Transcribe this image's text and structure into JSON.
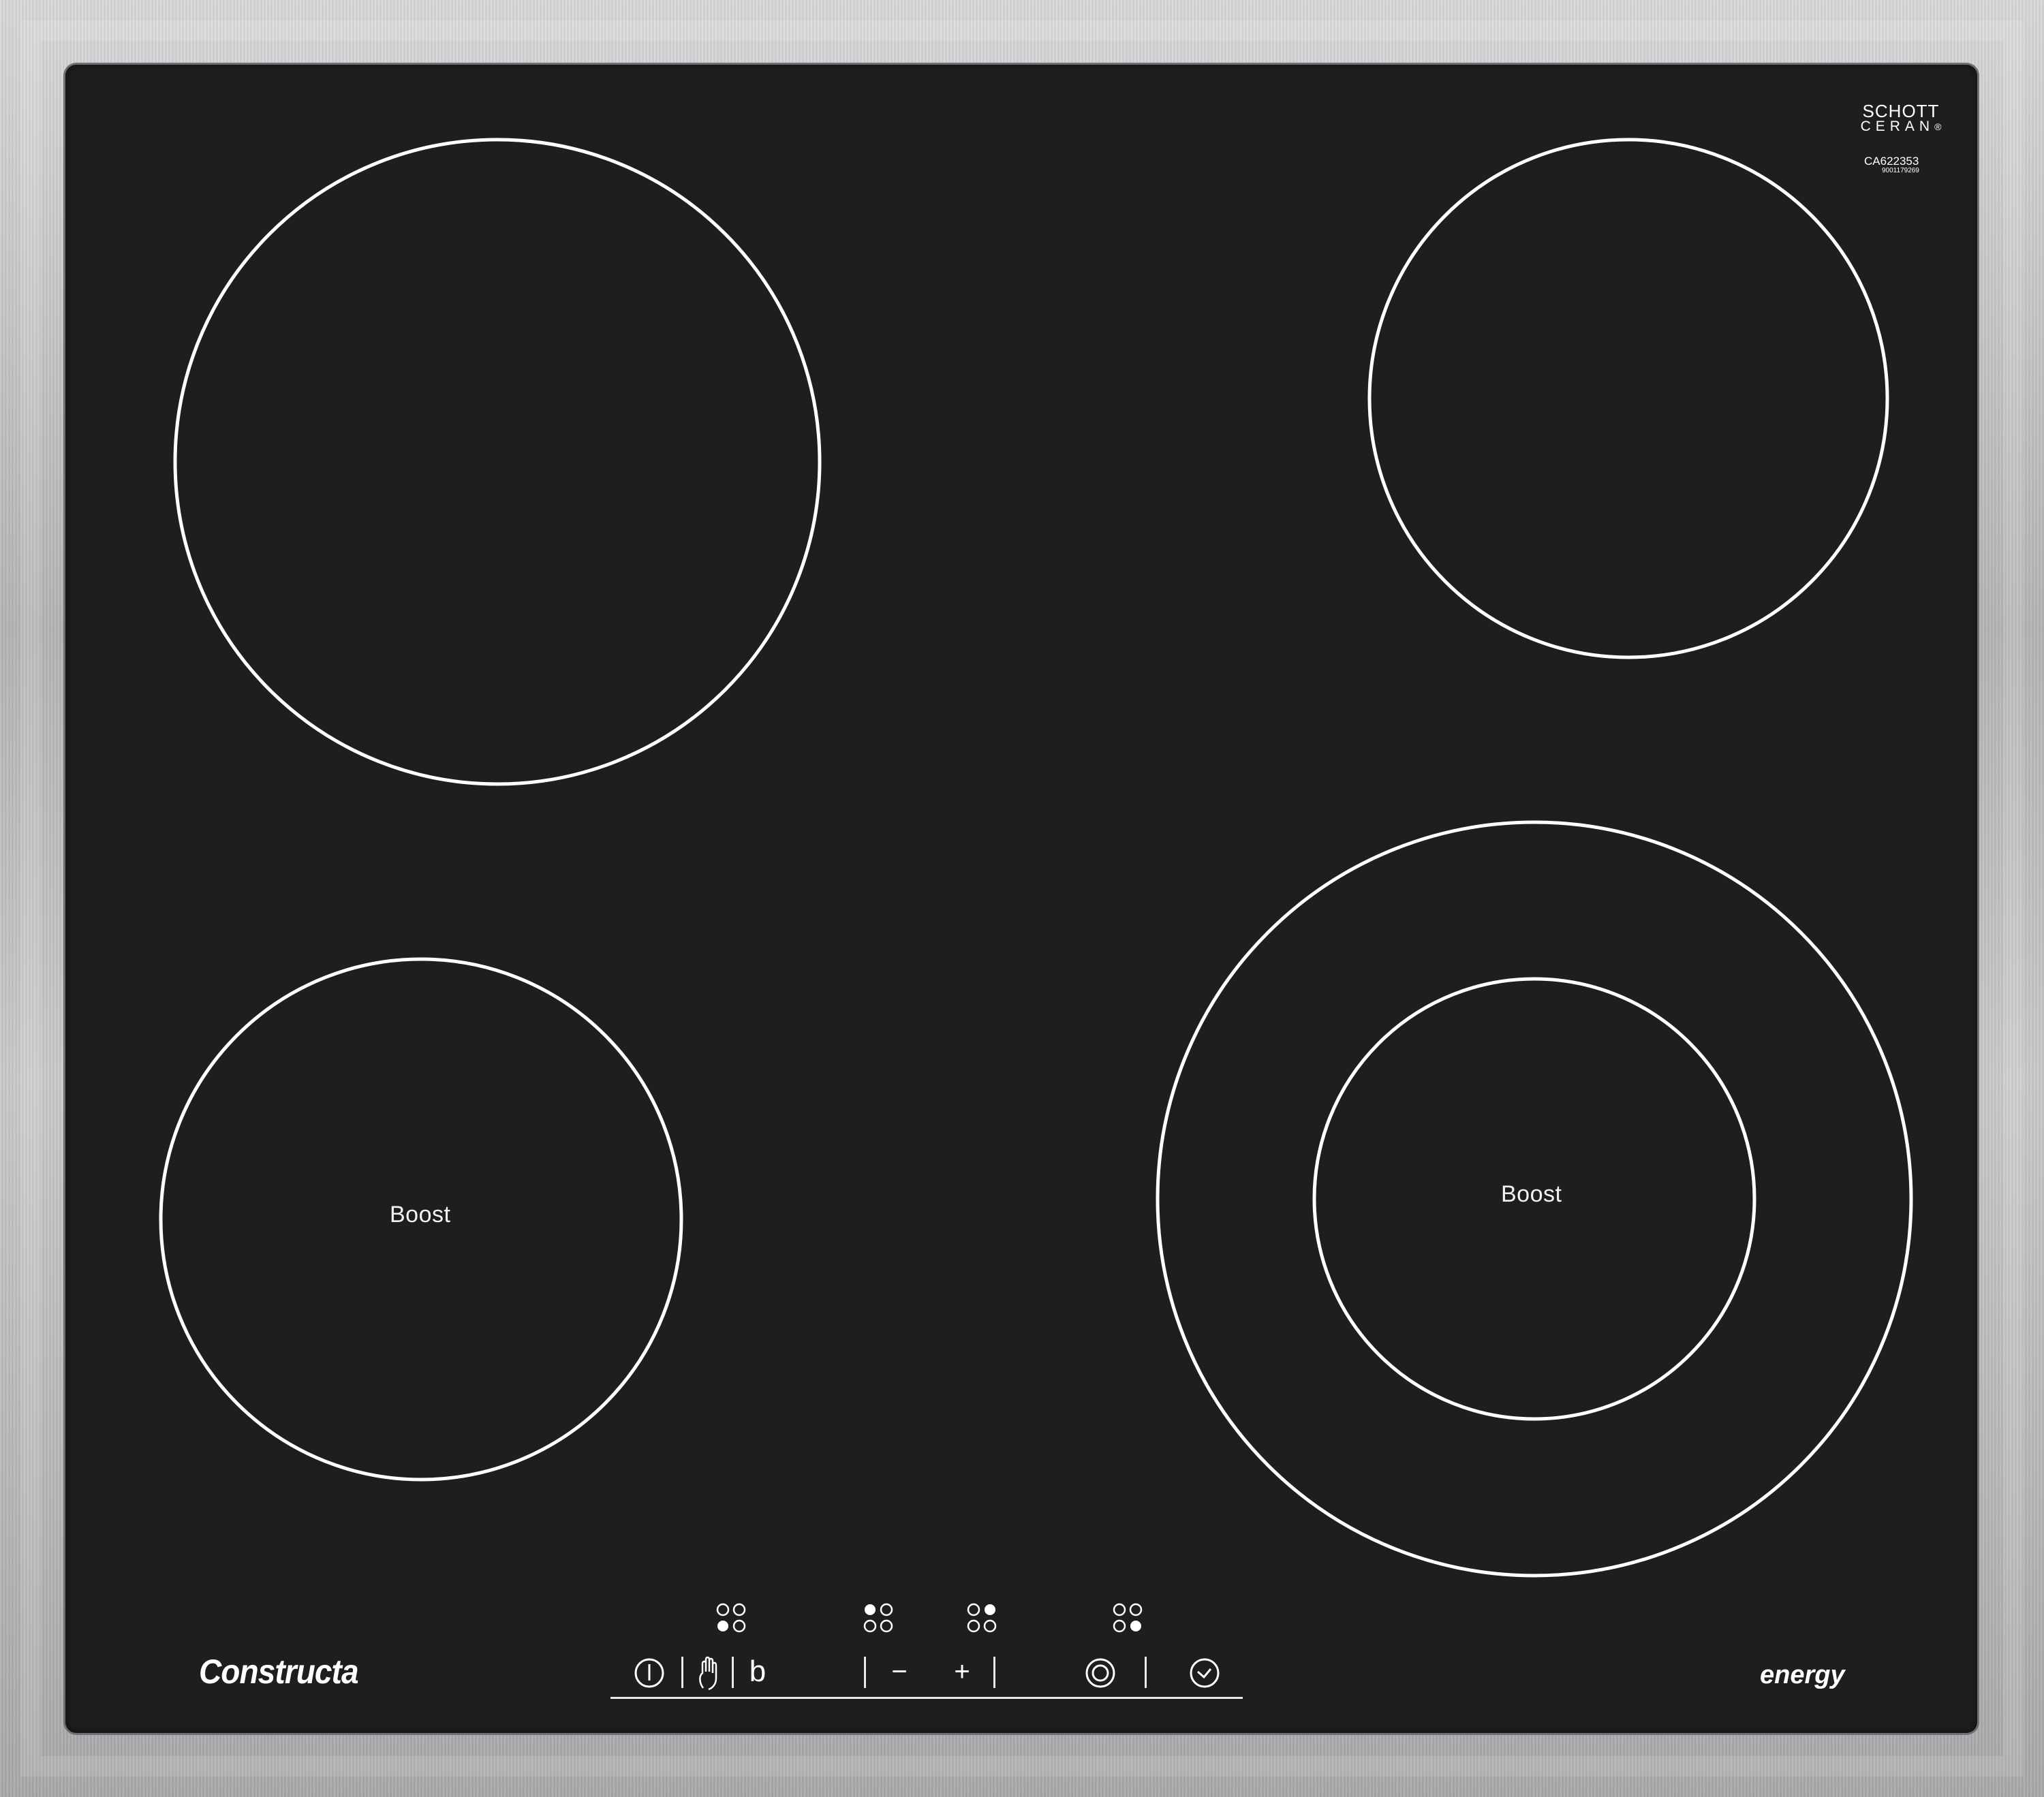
{
  "cooktop": {
    "frame_color": "#b8babc",
    "glass_color": "#1f1e1c",
    "marking_color": "#ffffff",
    "logo": {
      "line1": "SCHOTT",
      "line2": "CERAN",
      "registered": "®"
    },
    "model_code": "CA622353",
    "serial_number": "9001179269",
    "brand": "Constructa",
    "energy_label": "energy",
    "zones": [
      {
        "name": "rear-left",
        "label": ""
      },
      {
        "name": "rear-right",
        "label": ""
      },
      {
        "name": "front-left",
        "label": "Boost"
      },
      {
        "name": "front-right",
        "label": "Boost"
      }
    ],
    "controls": {
      "power_icon": "power-icon",
      "child_lock_icon": "hand-lock-icon",
      "display_digit": "b",
      "minus": "−",
      "plus": "+",
      "dual_zone_icon": "dual-ring-icon",
      "timer_icon": "clock-icon"
    }
  }
}
